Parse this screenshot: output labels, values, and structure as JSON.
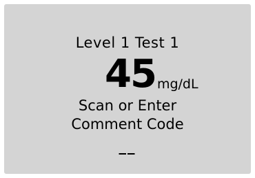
{
  "display": {
    "test_label": "Level 1 Test 1",
    "reading": {
      "value": "45",
      "unit": "mg/dL"
    },
    "prompt_line1": "Scan or Enter",
    "prompt_line2": "Comment Code",
    "code_entry": "__"
  }
}
